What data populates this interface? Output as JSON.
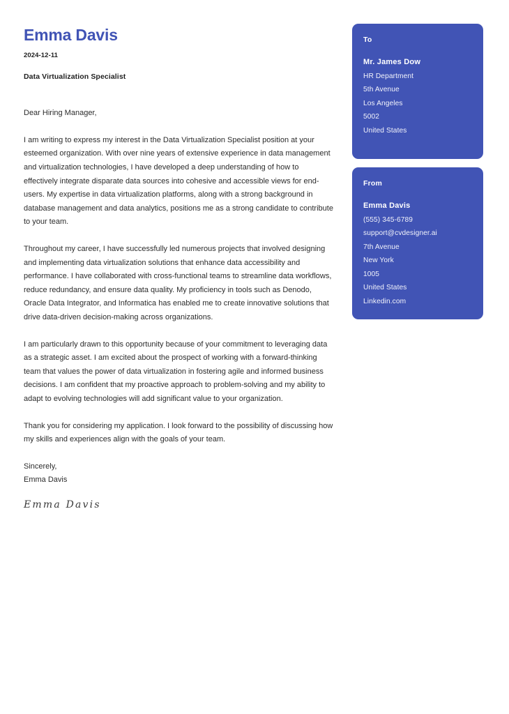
{
  "document": {
    "type": "cover-letter",
    "accent_color": "#4154b5",
    "background_color": "#ffffff",
    "body_text_color": "#2b2b2b"
  },
  "header": {
    "sender_name": "Emma Davis",
    "date": "2024-12-11",
    "job_title": "Data Virtualization Specialist"
  },
  "letter": {
    "salutation": "Dear Hiring Manager,",
    "paragraphs": [
      "I am writing to express my interest in the Data Virtualization Specialist position at your esteemed organization. With over nine years of extensive experience in data management and virtualization technologies, I have developed a deep understanding of how to effectively integrate disparate data sources into cohesive and accessible views for end-users. My expertise in data virtualization platforms, along with a strong background in database management and data analytics, positions me as a strong candidate to contribute to your team.",
      "Throughout my career, I have successfully led numerous projects that involved designing and implementing data virtualization solutions that enhance data accessibility and performance. I have collaborated with cross-functional teams to streamline data workflows, reduce redundancy, and ensure data quality. My proficiency in tools such as Denodo, Oracle Data Integrator, and Informatica has enabled me to create innovative solutions that drive data-driven decision-making across organizations.",
      "I am particularly drawn to this opportunity because of your commitment to leveraging data as a strategic asset. I am excited about the prospect of working with a forward-thinking team that values the power of data virtualization in fostering agile and informed business decisions. I am confident that my proactive approach to problem-solving and my ability to adapt to evolving technologies will add significant value to your organization.",
      "Thank you for considering my application. I look forward to the possibility of discussing how my skills and experiences align with the goals of your team."
    ],
    "closing_salutation": "Sincerely,",
    "closing_name": "Emma Davis",
    "signature": "Emma Davis"
  },
  "recipient_card": {
    "heading": "To",
    "name": "Mr. James Dow",
    "lines": [
      "HR Department",
      "5th Avenue",
      "Los Angeles",
      "5002",
      "United States"
    ]
  },
  "sender_card": {
    "heading": "From",
    "name": "Emma Davis",
    "lines": [
      "(555) 345-6789",
      "support@cvdesigner.ai",
      "7th Avenue",
      "New York",
      "1005",
      "United States",
      "Linkedin.com"
    ]
  }
}
